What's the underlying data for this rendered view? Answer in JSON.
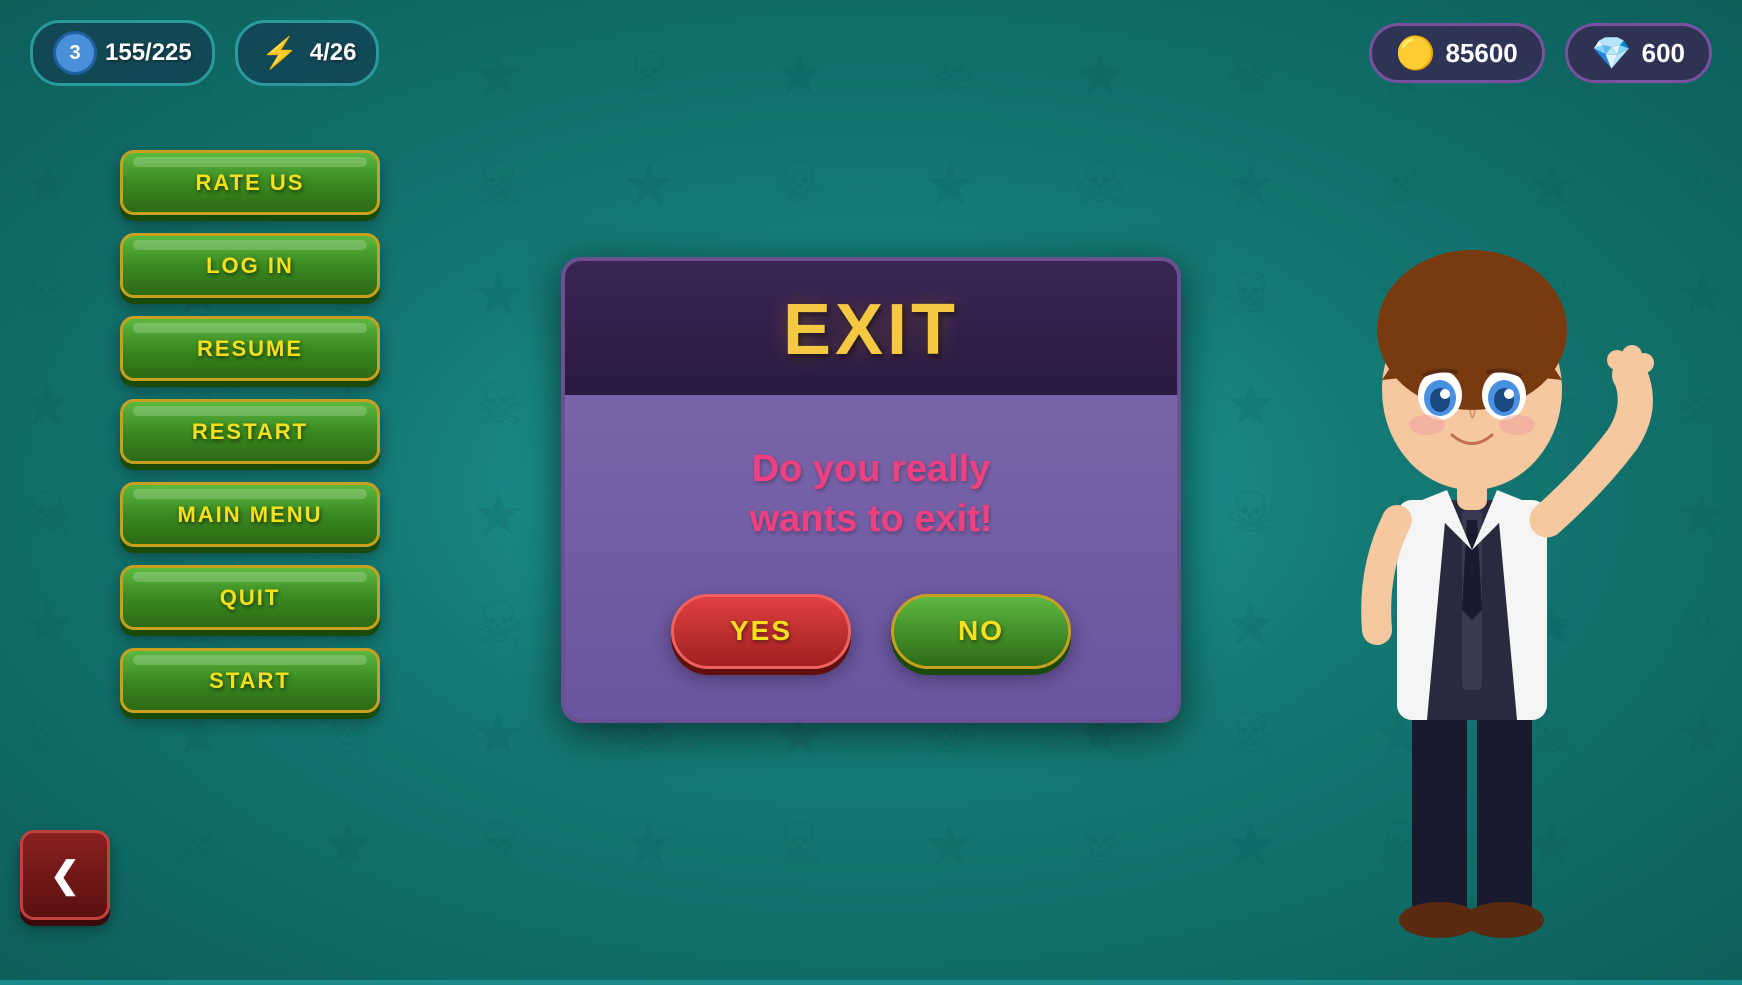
{
  "topBar": {
    "level": "3",
    "xp": "155/225",
    "energy": "4/26",
    "coins": "85600",
    "gems": "600"
  },
  "menu": {
    "buttons": [
      {
        "id": "rate-us",
        "label": "RATE US"
      },
      {
        "id": "log-in",
        "label": "LOG IN"
      },
      {
        "id": "resume",
        "label": "RESUME"
      },
      {
        "id": "restart",
        "label": "RESTART"
      },
      {
        "id": "main-menu",
        "label": "MAIN MENU"
      },
      {
        "id": "quit",
        "label": "QUIT"
      },
      {
        "id": "start",
        "label": "START"
      }
    ],
    "backArrow": "❮"
  },
  "dialog": {
    "title": "EXIT",
    "message": "Do you really\nwants to exit!",
    "yesLabel": "YES",
    "noLabel": "NO"
  }
}
